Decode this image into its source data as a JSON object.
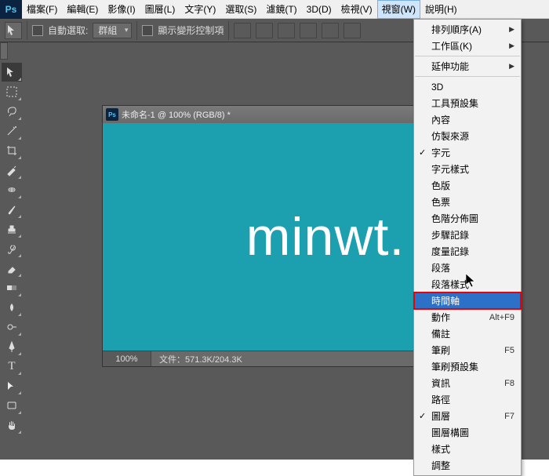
{
  "menubar": {
    "items": [
      "檔案(F)",
      "編輯(E)",
      "影像(I)",
      "圖層(L)",
      "文字(Y)",
      "選取(S)",
      "濾鏡(T)",
      "3D(D)",
      "檢視(V)",
      "視窗(W)",
      "說明(H)"
    ],
    "activeIndex": 9
  },
  "options": {
    "auto_select_label": "自動選取:",
    "dropdown_value": "群組",
    "show_transform_label": "顯示變形控制項"
  },
  "tools_left": [
    "move",
    "marquee",
    "lasso",
    "wand",
    "crop",
    "eyedrop",
    "heal",
    "brush",
    "stamp",
    "history",
    "eraser",
    "gradient",
    "blur",
    "dodge",
    "pen",
    "type",
    "path",
    "shape",
    "hand"
  ],
  "document": {
    "title": "未命名-1 @ 100% (RGB/8) *",
    "canvas_text": "minwt.",
    "zoom": "100%",
    "file_info": "文件：571.3K/204.3K"
  },
  "window_menu": {
    "top": [
      {
        "label": "排列順序(A)",
        "arrow": true
      },
      {
        "label": "工作區(K)",
        "arrow": true
      }
    ],
    "ext": [
      {
        "label": "延伸功能",
        "arrow": true
      }
    ],
    "panels": [
      {
        "label": "3D"
      },
      {
        "label": "工具預設集"
      },
      {
        "label": "內容"
      },
      {
        "label": "仿製來源"
      },
      {
        "label": "字元",
        "checked": true
      },
      {
        "label": "字元樣式"
      },
      {
        "label": "色版"
      },
      {
        "label": "色票"
      },
      {
        "label": "色階分佈圖"
      },
      {
        "label": "步驟記錄"
      },
      {
        "label": "度量記錄"
      },
      {
        "label": "段落"
      },
      {
        "label": "段落樣式"
      },
      {
        "label": "時間軸",
        "highlight": true
      },
      {
        "label": "動作",
        "shortcut": "Alt+F9"
      },
      {
        "label": "備註"
      },
      {
        "label": "筆刷",
        "shortcut": "F5"
      },
      {
        "label": "筆刷預設集"
      },
      {
        "label": "資訊",
        "shortcut": "F8"
      },
      {
        "label": "路徑"
      },
      {
        "label": "圖層",
        "shortcut": "F7",
        "checked": true
      },
      {
        "label": "圖層構圖"
      },
      {
        "label": "樣式"
      },
      {
        "label": "調整"
      }
    ]
  }
}
